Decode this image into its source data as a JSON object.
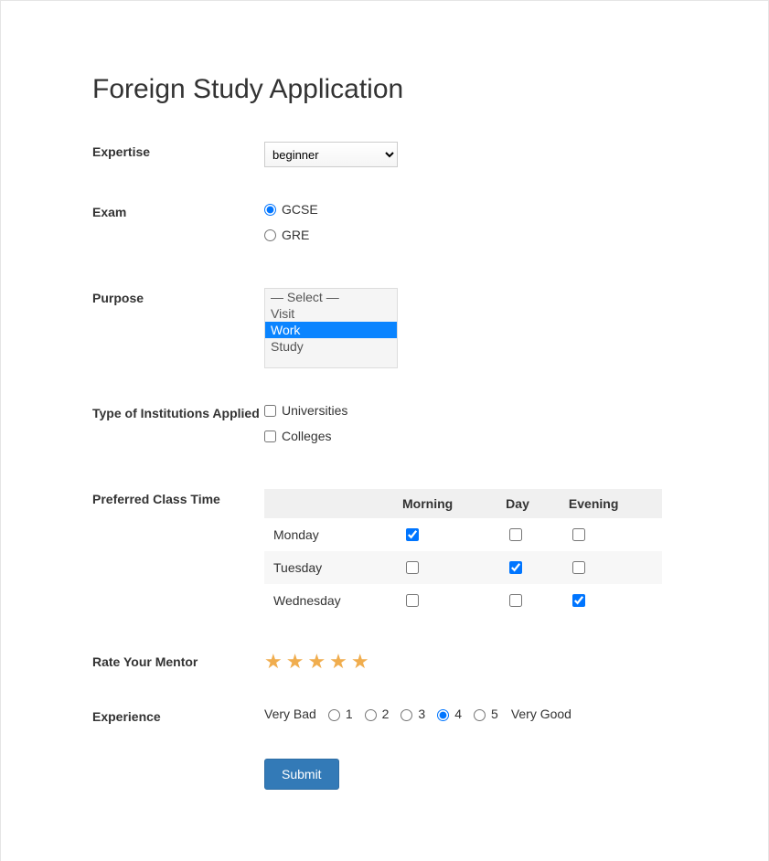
{
  "title": "Foreign Study Application",
  "expertise": {
    "label": "Expertise",
    "selected": "beginner"
  },
  "exam": {
    "label": "Exam",
    "options": [
      {
        "label": "GCSE",
        "selected": true
      },
      {
        "label": "GRE",
        "selected": false
      }
    ]
  },
  "purpose": {
    "label": "Purpose",
    "options": [
      {
        "label": "— Select —",
        "selected": false
      },
      {
        "label": "Visit",
        "selected": false
      },
      {
        "label": "Work",
        "selected": true
      },
      {
        "label": "Study",
        "selected": false
      }
    ]
  },
  "institutions": {
    "label": "Type of Institutions Applied",
    "options": [
      {
        "label": "Universities",
        "checked": false
      },
      {
        "label": "Colleges",
        "checked": false
      }
    ]
  },
  "classTime": {
    "label": "Preferred Class Time",
    "columns": [
      "",
      "Morning",
      "Day",
      "Evening"
    ],
    "rows": [
      {
        "day": "Monday",
        "morning": true,
        "midday": false,
        "evening": false
      },
      {
        "day": "Tuesday",
        "morning": false,
        "midday": true,
        "evening": false
      },
      {
        "day": "Wednesday",
        "morning": false,
        "midday": false,
        "evening": true
      }
    ]
  },
  "mentor": {
    "label": "Rate Your Mentor",
    "stars": 5
  },
  "experience": {
    "label": "Experience",
    "leftLabel": "Very Bad",
    "rightLabel": "Very Good",
    "options": [
      "1",
      "2",
      "3",
      "4",
      "5"
    ],
    "selected": "4"
  },
  "submit": {
    "label": "Submit"
  }
}
